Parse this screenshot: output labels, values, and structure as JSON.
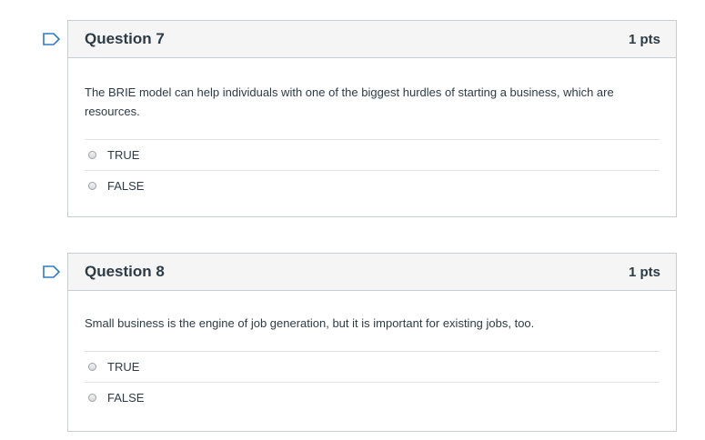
{
  "questions": [
    {
      "title": "Question 7",
      "points": "1 pts",
      "text": "The BRIE model can help individuals with one of the biggest hurdles of starting a business, which are resources.",
      "answers": [
        "TRUE",
        "FALSE"
      ]
    },
    {
      "title": "Question 8",
      "points": "1 pts",
      "text": "Small business is the engine of job generation, but it is important for existing jobs, too.",
      "answers": [
        "TRUE",
        "FALSE"
      ]
    }
  ],
  "colors": {
    "flag_icon": "#2d7bc4",
    "header_bg": "#f5f5f5",
    "border": "#c7cdd1",
    "text": "#2d3b45"
  },
  "icons": {
    "flag": "flag-question-icon",
    "radio": "radio-button-icon"
  }
}
